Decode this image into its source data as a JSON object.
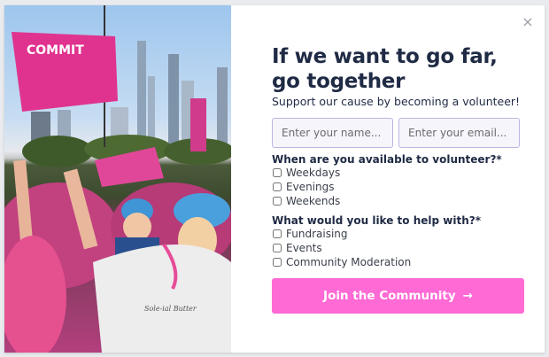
{
  "modal": {
    "close_glyph": "×",
    "title": "If we want to go far, go together",
    "subtitle": "Support our cause by becoming a volunteer!",
    "name_placeholder": "Enter your name...",
    "email_placeholder": "Enter your email...",
    "availability_question": "When are you available to volunteer?*",
    "availability_options": [
      "Weekdays",
      "Evenings",
      "Weekends"
    ],
    "help_question": "What would you like to help with?*",
    "help_options": [
      "Fundraising",
      "Events",
      "Community Moderation"
    ],
    "cta_label": "Join the Community",
    "cta_arrow": "→",
    "accent_color": "#ff6ad5"
  },
  "photo": {
    "flag_text": "COMMIT",
    "shirt_text": "Sole-ial Butter"
  }
}
